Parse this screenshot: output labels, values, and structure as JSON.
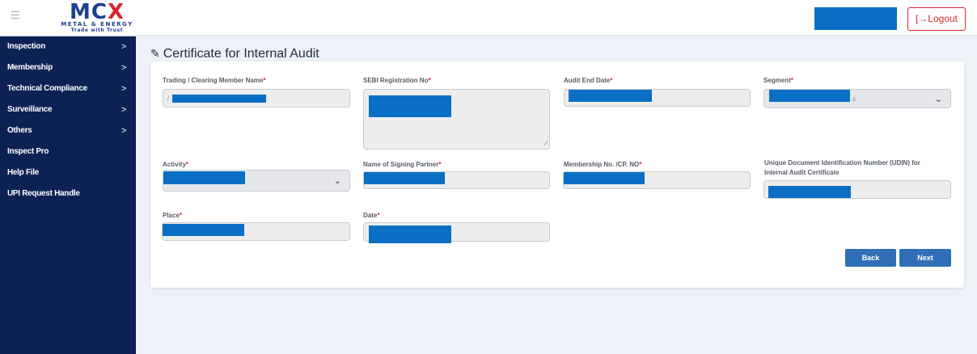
{
  "header": {
    "logo": {
      "main_left": "MC",
      "main_x": "X",
      "sub": "METAL & ENERGY",
      "tagline": "Trade with Trust"
    },
    "logout_label": "[→Logout"
  },
  "sidebar": {
    "items": [
      {
        "label": "Inspection",
        "chevron": ">"
      },
      {
        "label": "Membership",
        "chevron": ">"
      },
      {
        "label": "Technical Compliance",
        "chevron": ">"
      },
      {
        "label": "Surveillance",
        "chevron": ">"
      },
      {
        "label": "Others",
        "chevron": ">"
      },
      {
        "label": "Inspect Pro",
        "chevron": ""
      },
      {
        "label": "Help File",
        "chevron": ""
      },
      {
        "label": "UPI Request Handle",
        "chevron": ""
      }
    ]
  },
  "page": {
    "title": "Certificate for Internal Audit"
  },
  "form": {
    "trading_member_name": {
      "label": "Trading / Clearing Member Name",
      "value_prefix": "/"
    },
    "sebi_registration_no": {
      "label": "SEBI Registration No"
    },
    "audit_end_date": {
      "label": "Audit End Date"
    },
    "segment": {
      "label": "Segment",
      "value_suffix": "s"
    },
    "activity": {
      "label": "Activity"
    },
    "signing_partner": {
      "label": "Name of Signing Partner"
    },
    "membership_no": {
      "label": "Membership No. /CP. NO"
    },
    "udin": {
      "label_line1": "Unique Document Identification Number (UDIN) for",
      "label_line2": "Internal Audit Certificate"
    },
    "place": {
      "label": "Place"
    },
    "date": {
      "label": "Date"
    },
    "required_mark": "*"
  },
  "actions": {
    "back_label": "Back",
    "next_label": "Next"
  },
  "colors": {
    "sidebar": "#0c2254",
    "mask": "#0a6fc4",
    "button": "#2f6fb5",
    "logout": "#d8262f"
  }
}
